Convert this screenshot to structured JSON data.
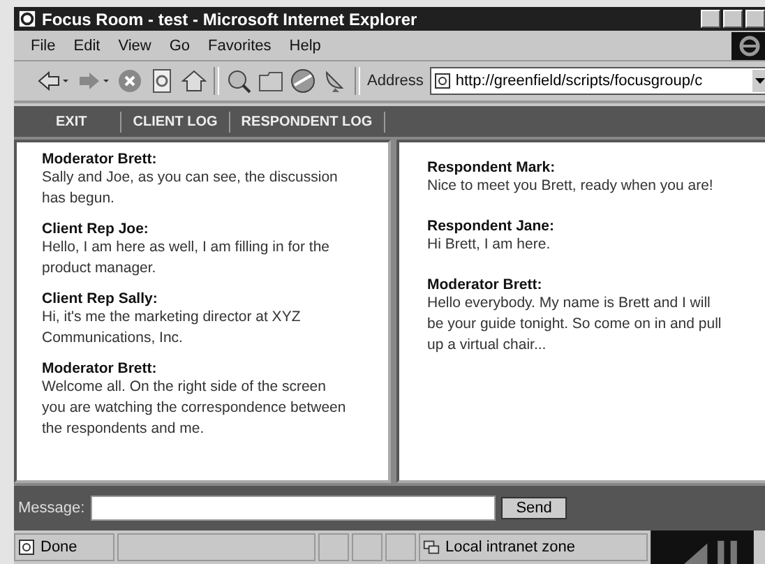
{
  "window": {
    "title": "Focus Room - test - Microsoft Internet Explorer"
  },
  "menu": [
    "File",
    "Edit",
    "View",
    "Go",
    "Favorites",
    "Help"
  ],
  "address": {
    "label": "Address",
    "value": "http://greenfield/scripts/focusgroup/c"
  },
  "nav": [
    "EXIT",
    "CLIENT LOG",
    "RESPONDENT LOG"
  ],
  "client_log": [
    {
      "speaker": "Moderator Brett:",
      "text": "Sally and Joe, as you can see, the discussion has begun."
    },
    {
      "speaker": "Client Rep Joe:",
      "text": "Hello, I am here as well, I am filling in for the product manager."
    },
    {
      "speaker": "Client Rep Sally:",
      "text": "Hi, it's me the marketing director at XYZ Communications, Inc."
    },
    {
      "speaker": "Moderator Brett:",
      "text": "Welcome all. On the right side of the screen you are watching the correspondence between the respondents and me."
    }
  ],
  "respondent_log": [
    {
      "speaker": "Respondent Mark:",
      "text": "Nice to meet you Brett, ready when you are!"
    },
    {
      "speaker": "Respondent Jane:",
      "text": "Hi Brett, I am here."
    },
    {
      "speaker": "Moderator Brett:",
      "text": "Hello everybody. My name is Brett and I will be your guide tonight. So come on in and pull up a virtual chair..."
    }
  ],
  "message": {
    "label": "Message:",
    "button": "Send"
  },
  "status_bar": {
    "status": "Done",
    "zone": "Local intranet zone"
  }
}
